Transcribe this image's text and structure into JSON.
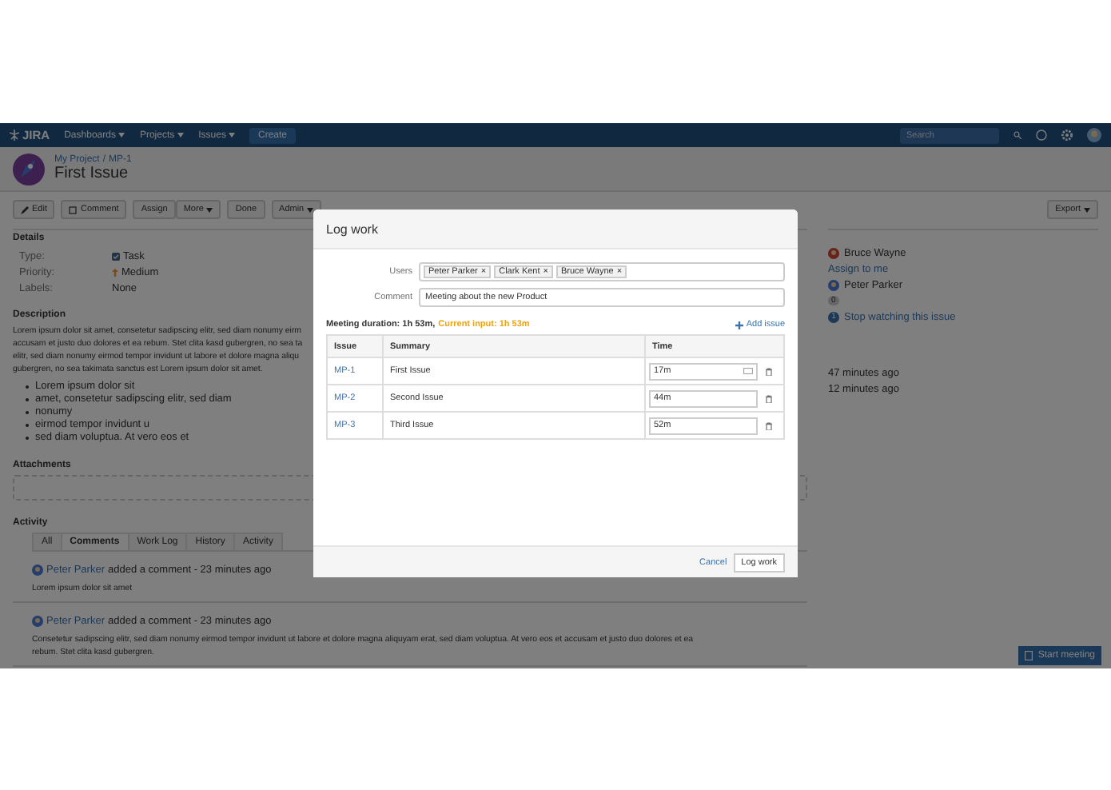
{
  "header": {
    "logo": "JIRA",
    "nav": [
      {
        "label": "Dashboards"
      },
      {
        "label": "Projects"
      },
      {
        "label": "Issues"
      }
    ],
    "create": "Create",
    "search": {
      "placeholder": "Search"
    }
  },
  "issue": {
    "project": "My Project",
    "separator": "/",
    "key": "MP-1",
    "title": "First Issue"
  },
  "toolbar": {
    "groups": [
      [
        {
          "label": "Edit",
          "kind": "edit"
        }
      ],
      [
        {
          "label": "Comment",
          "kind": "comment"
        }
      ],
      [
        {
          "label": "Assign",
          "kind": "action"
        },
        {
          "label": "More",
          "kind": "menu"
        }
      ],
      [
        {
          "label": "Done",
          "kind": "action"
        }
      ],
      [
        {
          "label": "Admin",
          "kind": "menu"
        }
      ]
    ],
    "export": "Export"
  },
  "details": {
    "heading": "Details",
    "fields": [
      {
        "label": "Type:",
        "value": "Task",
        "kind": "type"
      },
      {
        "label": "Priority:",
        "value": "Medium",
        "kind": "priority"
      },
      {
        "label": "Labels:",
        "value": "None",
        "kind": "plain"
      }
    ]
  },
  "people": {
    "assignee": "Bruce Wayne",
    "assign_link": "Assign to me",
    "reporter": "Peter Parker",
    "votes": "0",
    "watchers": "1",
    "watch_link": "Stop watching this issue"
  },
  "dates": [
    "47 minutes ago",
    "12 minutes ago"
  ],
  "description": {
    "heading": "Description",
    "lines": [
      "Lorem ipsum dolor sit amet, consetetur sadipscing elitr, sed diam nonumy eirm",
      "accusam et justo duo dolores et ea rebum. Stet clita kasd gubergren, no sea ta",
      "elitr, sed diam nonumy eirmod tempor invidunt ut labore et dolore magna aliqu",
      "gubergren, no sea takimata sanctus est Lorem ipsum dolor sit amet."
    ],
    "bullets": [
      "Lorem ipsum dolor sit",
      "amet, consetetur sadipscing elitr, sed diam",
      "nonumy",
      "eirmod tempor invidunt u",
      "sed diam voluptua. At vero eos et"
    ]
  },
  "attachments": {
    "heading": "Attachments"
  },
  "activity": {
    "heading": "Activity",
    "tabs": [
      {
        "label": "All",
        "selected": false
      },
      {
        "label": "Comments",
        "selected": true
      },
      {
        "label": "Work Log",
        "selected": false
      },
      {
        "label": "History",
        "selected": false
      },
      {
        "label": "Activity",
        "selected": false
      }
    ],
    "comments": [
      {
        "author": "Peter Parker",
        "meta": "added a comment - 23 minutes ago",
        "lines": [
          "Lorem ipsum dolor sit amet"
        ]
      },
      {
        "author": "Peter Parker",
        "meta": "added a comment - 23 minutes ago",
        "lines": [
          "Consetetur sadipscing elitr, sed diam nonumy eirmod tempor invidunt ut labore et dolore magna aliquyam erat, sed diam voluptua. At vero eos et accusam et justo duo dolores et ea",
          "rebum. Stet clita kasd gubergren."
        ]
      }
    ]
  },
  "start_meeting": "Start meeting",
  "dialog": {
    "title": "Log work",
    "users_label": "Users",
    "users": [
      {
        "label": "Peter Parker",
        "remove": "×"
      },
      {
        "label": "Clark Kent",
        "remove": "×"
      },
      {
        "label": "Bruce Wayne",
        "remove": "×"
      }
    ],
    "comment_label": "Comment",
    "comment": "Meeting about the new Product",
    "duration": "Meeting duration: 1h 53m,",
    "current_input": "Current input: 1h 53m",
    "add_issue": "Add issue",
    "columns": [
      "Issue",
      "Summary",
      "Time"
    ],
    "rows": [
      {
        "issue": "MP-1",
        "summary": "First Issue",
        "time": "17m",
        "picker": true
      },
      {
        "issue": "MP-2",
        "summary": "Second Issue",
        "time": "44m",
        "picker": false
      },
      {
        "issue": "MP-3",
        "summary": "Third Issue",
        "time": "52m",
        "picker": false
      }
    ],
    "cancel": "Cancel",
    "submit": "Log work"
  }
}
